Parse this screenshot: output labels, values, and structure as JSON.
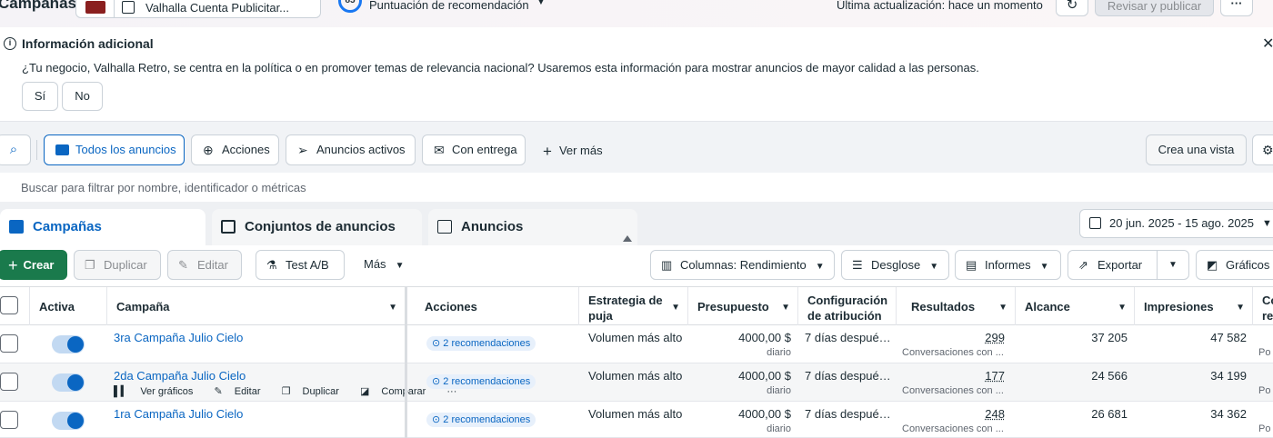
{
  "topbar": {
    "title": "Campañas",
    "account_name": "Valhalla Cuenta Publicitar...",
    "score_value": "85",
    "score_label": "Puntuación de recomendación",
    "last_update": "Última actualización: hace un momento",
    "review_button": "Revisar y publicar",
    "more_button": "···"
  },
  "info": {
    "heading": "Información adicional",
    "message": "¿Tu negocio, Valhalla Retro, se centra en la política o en promover temas de relevancia nacional? Usaremos esta información para mostrar anuncios de mayor calidad a las personas.",
    "yes": "Sí",
    "no": "No"
  },
  "filters": {
    "all_ads": "Todos los anuncios",
    "actions": "Acciones",
    "active_ads": "Anuncios activos",
    "with_delivery": "Con entrega",
    "see_more": "Ver más",
    "create_view": "Crea una vista",
    "search_placeholder": "Buscar para filtrar por nombre, identificador o métricas"
  },
  "tabs": {
    "campaigns": "Campañas",
    "adsets": "Conjuntos de anuncios",
    "ads": "Anuncios"
  },
  "date_range": "20 jun. 2025 - 15 ago. 2025",
  "toolbar": {
    "create": "Crear",
    "duplicate": "Duplicar",
    "edit": "Editar",
    "ab_test": "Test A/B",
    "more": "Más",
    "columns": "Columnas: Rendimiento",
    "breakdown": "Desglose",
    "reports": "Informes",
    "export": "Exportar",
    "charts": "Gráficos"
  },
  "table": {
    "headers": {
      "active": "Activa",
      "campaign": "Campaña",
      "actions": "Acciones",
      "strategy_1": "Estrategia de",
      "strategy_2": "puja",
      "budget": "Presupuesto",
      "attribution_1": "Configuración",
      "attribution_2": "de atribución",
      "results": "Resultados",
      "reach": "Alcance",
      "impressions": "Impresiones",
      "clipped_1": "Co",
      "clipped_2": "re"
    },
    "row_actions": {
      "charts": "Ver gráficos",
      "edit": "Editar",
      "duplicate": "Duplicar",
      "compare": "Comparar",
      "more": "···"
    },
    "rows": [
      {
        "name": "3ra Campaña Julio Cielo",
        "recommendations": "2 recomendaciones",
        "strategy": "Volumen más alto",
        "budget": "4000,00 $",
        "budget_period": "diario",
        "attribution": "7 días despué…",
        "results": "299",
        "results_label": "Conversaciones con ...",
        "reach": "37 205",
        "impressions": "47 582",
        "clipped": "Po"
      },
      {
        "name": "2da Campaña Julio Cielo",
        "recommendations": "2 recomendaciones",
        "strategy": "Volumen más alto",
        "budget": "4000,00 $",
        "budget_period": "diario",
        "attribution": "7 días despué…",
        "results": "177",
        "results_label": "Conversaciones con ...",
        "reach": "24 566",
        "impressions": "34 199",
        "clipped": "Po"
      },
      {
        "name": "1ra Campaña Julio Cielo",
        "recommendations": "2 recomendaciones",
        "strategy": "Volumen más alto",
        "budget": "4000,00 $",
        "budget_period": "diario",
        "attribution": "7 días despué…",
        "results": "248",
        "results_label": "Conversaciones con ...",
        "reach": "26 681",
        "impressions": "34 362",
        "clipped": "Po"
      }
    ]
  },
  "colors": {
    "accent": "#0a66c2",
    "create_green": "#1a7a4c",
    "toggle_on": "#0a66c2"
  },
  "icons": [
    "info-icon",
    "close-icon",
    "search-icon",
    "folder-icon",
    "refresh-icon",
    "calendar-icon",
    "plus-icon",
    "chevron-down-icon"
  ]
}
